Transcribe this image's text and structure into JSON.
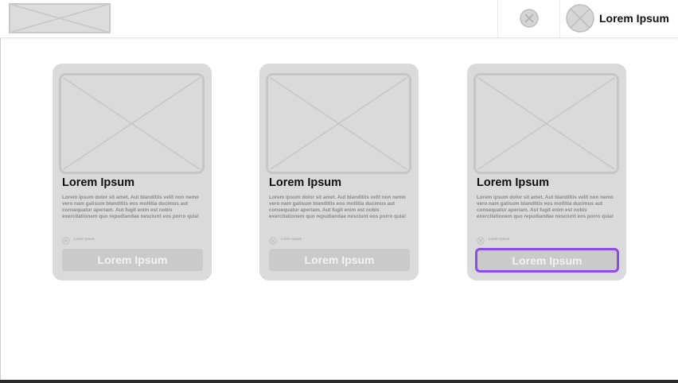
{
  "header": {
    "logo_icon": "image-placeholder-icon",
    "close_icon": "close-circle-icon",
    "user": {
      "avatar_icon": "avatar-placeholder-icon",
      "name": "Lorem Ipsum"
    }
  },
  "cards": [
    {
      "image_icon": "image-placeholder-icon",
      "title": "Lorem Ipsum",
      "description": "Lorem ipsum dolor sit amet. Aut blanditiis velit non nemo vero nam galisum blanditiis eos mollitia ducimus aut consequatur aperiam. Aut fugit enim est nobis exercitationem quo repudiandae nesciunt eos porro quia!",
      "meta_icon": "close-circle-icon",
      "meta_text": "Lorem Ipsum",
      "button_label": "Lorem Ipsum",
      "selected": false
    },
    {
      "image_icon": "image-placeholder-icon",
      "title": "Lorem Ipsum",
      "description": "Lorem ipsum dolor sit amet. Aut blanditiis velit non nemo vero nam galisum blanditiis eos mollitia ducimus aut consequatur aperiam. Aut fugit enim est nobis exercitationem quo repudiandae nesciunt eos porro quia!",
      "meta_icon": "close-circle-icon",
      "meta_text": "Lorem Ipsum",
      "button_label": "Lorem Ipsum",
      "selected": false
    },
    {
      "image_icon": "image-placeholder-icon",
      "title": "Lorem Ipsum",
      "description": "Lorem ipsum dolor sit amet. Aut blanditiis velit non nemo vero nam galisum blanditiis eos mollitia ducimus aut consequatur aperiam. Aut fugit enim est nobis exercitationem quo repudiandae nesciunt eos porro quia!",
      "meta_icon": "close-circle-icon",
      "meta_text": "Lorem Ipsum",
      "button_label": "Lorem Ipsum",
      "selected": true
    }
  ],
  "colors": {
    "card_background": "#dadada",
    "placeholder_stroke": "#c8c8c8",
    "button_background": "#cacaca",
    "selection_outline": "#8b4cf0"
  }
}
